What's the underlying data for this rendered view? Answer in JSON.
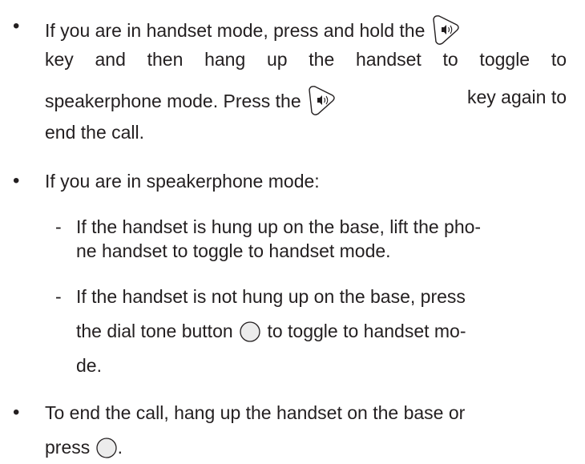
{
  "items": [
    {
      "bullet": "•",
      "lines": [
        [
          "If you are in handset mode, press and hold the",
          "speaker-key-icon"
        ],
        [
          "key and then hang up the handset to toggle to"
        ],
        [
          "speakerphone mode. Press the",
          "speaker-key-icon",
          "key again to"
        ],
        [
          "end the call."
        ]
      ]
    },
    {
      "bullet": "•",
      "text": "If you are in speakerphone mode:"
    }
  ],
  "sub_items": [
    {
      "dash": "-",
      "line1": "If the handset is hung up on the base, lift the pho-",
      "line2": "ne handset to toggle to handset mode."
    },
    {
      "dash": "-",
      "line1": "If the handset is not hung up on the base, press",
      "line2a": "the dial tone button",
      "line2b": "to toggle to handset mo-",
      "line3": "de."
    }
  ],
  "last_item": {
    "bullet": "•",
    "line1": "To end the call, hang up the handset on the base or",
    "line2": "press",
    "line2_end": "."
  },
  "icons": {
    "speaker_key": "speaker-key-icon",
    "dial_tone": "dial-tone-button-icon"
  }
}
